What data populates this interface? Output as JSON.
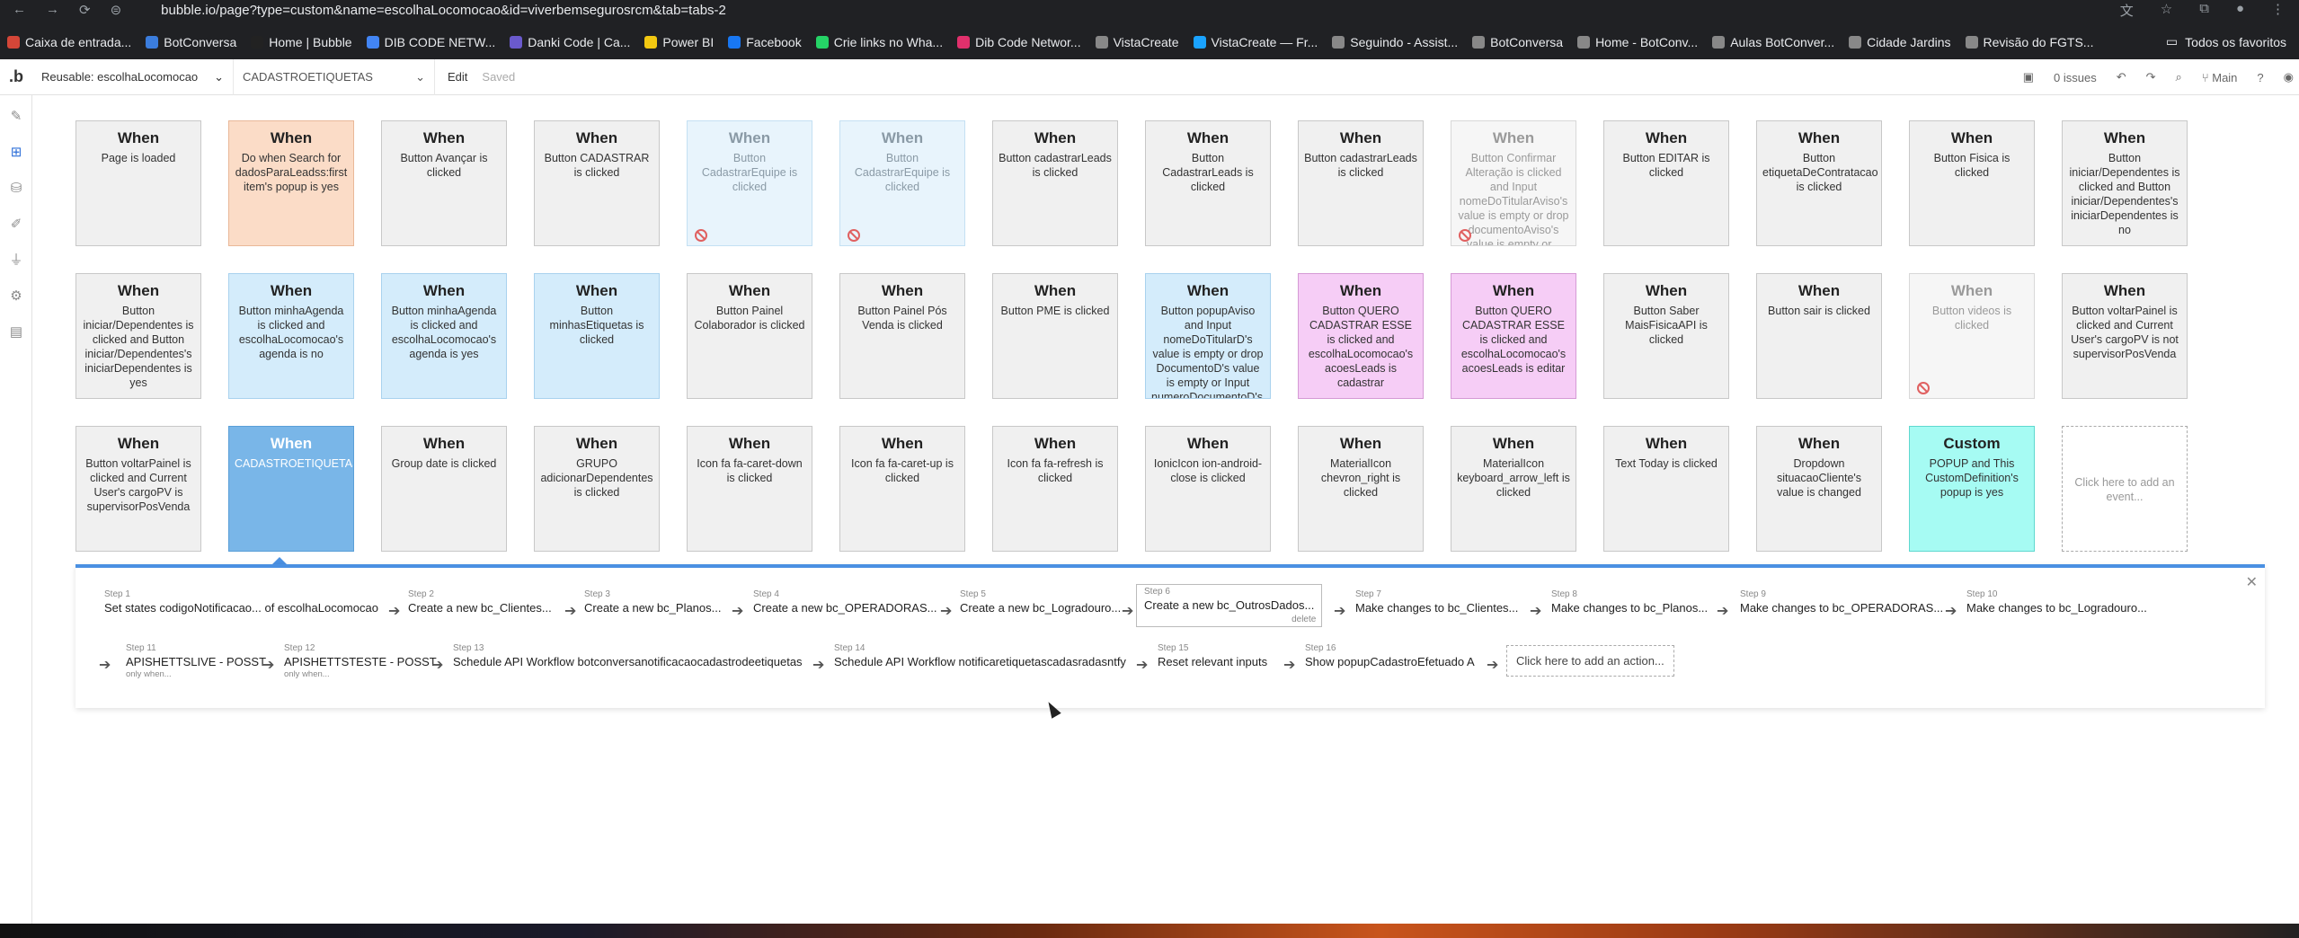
{
  "browser": {
    "url": "bubble.io/page?type=custom&name=escolhaLocomocao&id=viverbemsegurosrcm&tab=tabs-2",
    "bookmarks": [
      {
        "label": "Caixa de entrada...",
        "icon": "gmail-icon",
        "color": "#d44638"
      },
      {
        "label": "BotConversa",
        "icon": "botconversa-icon",
        "color": "#3b7ddd"
      },
      {
        "label": "Home | Bubble",
        "icon": "bubble-icon",
        "color": "#222222"
      },
      {
        "label": "DIB CODE NETW...",
        "icon": "google-icon",
        "color": "#4285f4"
      },
      {
        "label": "Danki Code | Ca...",
        "icon": "danki-icon",
        "color": "#6a5acd"
      },
      {
        "label": "Power BI",
        "icon": "powerbi-icon",
        "color": "#f2c811"
      },
      {
        "label": "Facebook",
        "icon": "facebook-icon",
        "color": "#1877f2"
      },
      {
        "label": "Crie links no Wha...",
        "icon": "link-icon",
        "color": "#25d366"
      },
      {
        "label": "Dib Code Networ...",
        "icon": "instagram-icon",
        "color": "#e1306c"
      },
      {
        "label": "VistaCreate",
        "icon": "globe-icon",
        "color": "#888888"
      },
      {
        "label": "VistaCreate — Fr...",
        "icon": "vistacreate-icon",
        "color": "#1aa3ff"
      },
      {
        "label": "Seguindo - Assist...",
        "icon": "globe-icon",
        "color": "#888888"
      },
      {
        "label": "BotConversa",
        "icon": "globe-icon",
        "color": "#888888"
      },
      {
        "label": "Home - BotConv...",
        "icon": "globe-icon",
        "color": "#888888"
      },
      {
        "label": "Aulas BotConver...",
        "icon": "globe-icon",
        "color": "#888888"
      },
      {
        "label": "Cidade Jardins",
        "icon": "globe-icon",
        "color": "#888888"
      },
      {
        "label": "Revisão do FGTS...",
        "icon": "globe-icon",
        "color": "#888888"
      }
    ],
    "all_favorites": "Todos os favoritos"
  },
  "topbar": {
    "logo": ".b",
    "page_select": "Reusable: escolhaLocomocao",
    "folder_select": "CADASTROETIQUETAS",
    "edit": "Edit",
    "saved": "Saved",
    "issues": "0 issues",
    "branch": "Main"
  },
  "events": [
    {
      "title": "When",
      "desc": "Page is loaded",
      "style": "normal"
    },
    {
      "title": "When",
      "desc": "Do when Search for dadosParaLeadss:first item's popup is yes",
      "style": "orange"
    },
    {
      "title": "When",
      "desc": "Button Avançar is clicked",
      "style": "normal"
    },
    {
      "title": "When",
      "desc": "Button CADASTRAR is clicked",
      "style": "normal"
    },
    {
      "title": "When",
      "desc": "Button CadastrarEquipe is clicked",
      "style": "lightblue",
      "disabled": true
    },
    {
      "title": "When",
      "desc": "Button CadastrarEquipe is clicked",
      "style": "lightblue",
      "disabled": true
    },
    {
      "title": "When",
      "desc": "Button cadastrarLeads is clicked",
      "style": "normal"
    },
    {
      "title": "When",
      "desc": "Button CadastrarLeads is clicked",
      "style": "normal"
    },
    {
      "title": "When",
      "desc": "Button cadastrarLeads is clicked",
      "style": "normal"
    },
    {
      "title": "When",
      "desc": "Button Confirmar Alteração is clicked and Input nomeDoTitularAviso's value is empty or drop documentoAviso's value is empty or...",
      "style": "greyed",
      "disabled": true
    },
    {
      "title": "When",
      "desc": "Button EDITAR is clicked",
      "style": "normal"
    },
    {
      "title": "When",
      "desc": "Button etiquetaDeContratacao is clicked",
      "style": "normal"
    },
    {
      "title": "When",
      "desc": "Button Fisica is clicked",
      "style": "normal"
    },
    {
      "title": "When",
      "desc": "Button iniciar/Dependentes is clicked and Button iniciar/Dependentes's iniciarDependentes is no",
      "style": "normal"
    },
    {
      "title": "When",
      "desc": "Button iniciar/Dependentes is clicked and Button iniciar/Dependentes's iniciarDependentes is yes",
      "style": "normal"
    },
    {
      "title": "When",
      "desc": "Button minhaAgenda is clicked and escolhaLocomocao's agenda is no",
      "style": "blue"
    },
    {
      "title": "When",
      "desc": "Button minhaAgenda is clicked and escolhaLocomocao's agenda is yes",
      "style": "blue"
    },
    {
      "title": "When",
      "desc": "Button minhasEtiquetas is clicked",
      "style": "blue"
    },
    {
      "title": "When",
      "desc": "Button Painel Colaborador is clicked",
      "style": "normal"
    },
    {
      "title": "When",
      "desc": "Button Painel Pós Venda is clicked",
      "style": "normal"
    },
    {
      "title": "When",
      "desc": "Button PME is clicked",
      "style": "normal"
    },
    {
      "title": "When",
      "desc": "Button popupAviso and Input nomeDoTitularD's value is empty or drop DocumentoD's value is empty or Input numeroDocumentoD's...",
      "style": "blue"
    },
    {
      "title": "When",
      "desc": "Button QUERO CADASTRAR ESSE is clicked and escolhaLocomocao's acoesLeads is cadastrar",
      "style": "pink"
    },
    {
      "title": "When",
      "desc": "Button QUERO CADASTRAR ESSE is clicked and escolhaLocomocao's acoesLeads is editar",
      "style": "pink"
    },
    {
      "title": "When",
      "desc": "Button Saber MaisFisicaAPI is clicked",
      "style": "normal"
    },
    {
      "title": "When",
      "desc": "Button sair is clicked",
      "style": "normal"
    },
    {
      "title": "When",
      "desc": "Button videos is clicked",
      "style": "greyed",
      "disabled": true
    },
    {
      "title": "When",
      "desc": "Button voltarPainel is clicked and Current User's cargoPV is not supervisorPosVenda",
      "style": "normal"
    },
    {
      "title": "When",
      "desc": "Button voltarPainel is clicked and Current User's cargoPV is supervisorPosVenda",
      "style": "normal"
    },
    {
      "title": "When",
      "desc": "CADASTROETIQUETAS",
      "style": "selected"
    },
    {
      "title": "When",
      "desc": "Group date is clicked",
      "style": "normal"
    },
    {
      "title": "When",
      "desc": "GRUPO adicionarDependentes is clicked",
      "style": "normal"
    },
    {
      "title": "When",
      "desc": "Icon fa fa-caret-down is clicked",
      "style": "normal"
    },
    {
      "title": "When",
      "desc": "Icon fa fa-caret-up is clicked",
      "style": "normal"
    },
    {
      "title": "When",
      "desc": "Icon fa fa-refresh is clicked",
      "style": "normal"
    },
    {
      "title": "When",
      "desc": "IonicIcon ion-android-close is clicked",
      "style": "normal"
    },
    {
      "title": "When",
      "desc": "MaterialIcon chevron_right is clicked",
      "style": "normal"
    },
    {
      "title": "When",
      "desc": "MaterialIcon keyboard_arrow_left is clicked",
      "style": "normal"
    },
    {
      "title": "When",
      "desc": "Text Today is clicked",
      "style": "normal"
    },
    {
      "title": "When",
      "desc": "Dropdown situacaoCliente's value is changed",
      "style": "normal"
    },
    {
      "title": "Custom",
      "desc": "POPUP and This CustomDefinition's popup is yes",
      "style": "cyan"
    },
    {
      "title": "",
      "desc": "Click here to add an event...",
      "style": "add"
    }
  ],
  "workflow": {
    "steps": [
      {
        "label": "Step 1",
        "text": "Set states codigoNotificacao... of escolhaLocomocao"
      },
      {
        "label": "Step 2",
        "text": "Create a new bc_Clientes..."
      },
      {
        "label": "Step 3",
        "text": "Create a new bc_Planos..."
      },
      {
        "label": "Step 4",
        "text": "Create a new bc_OPERADORAS..."
      },
      {
        "label": "Step 5",
        "text": "Create a new bc_Logradouro..."
      },
      {
        "label": "Step 6",
        "text": "Create a new bc_OutrosDados...",
        "delete": "delete"
      },
      {
        "label": "Step 7",
        "text": "Make changes to bc_Clientes..."
      },
      {
        "label": "Step 8",
        "text": "Make changes to bc_Planos..."
      },
      {
        "label": "Step 9",
        "text": "Make changes to bc_OPERADORAS..."
      },
      {
        "label": "Step 10",
        "text": "Make changes to bc_Logradouro..."
      },
      {
        "label": "Step 11",
        "text": "APISHETTSLIVE - POSST",
        "sub": "only when..."
      },
      {
        "label": "Step 12",
        "text": "APISHETTSTESTE - POSST",
        "sub": "only when..."
      },
      {
        "label": "Step 13",
        "text": "Schedule API Workflow botconversanotificacaocadastrodeetiquetas"
      },
      {
        "label": "Step 14",
        "text": "Schedule API Workflow notificaretiquetascadasradasntfy"
      },
      {
        "label": "Step 15",
        "text": "Reset relevant inputs"
      },
      {
        "label": "Step 16",
        "text": "Show popupCadastroEfetuado A"
      }
    ],
    "add_action": "Click here to add an action..."
  }
}
